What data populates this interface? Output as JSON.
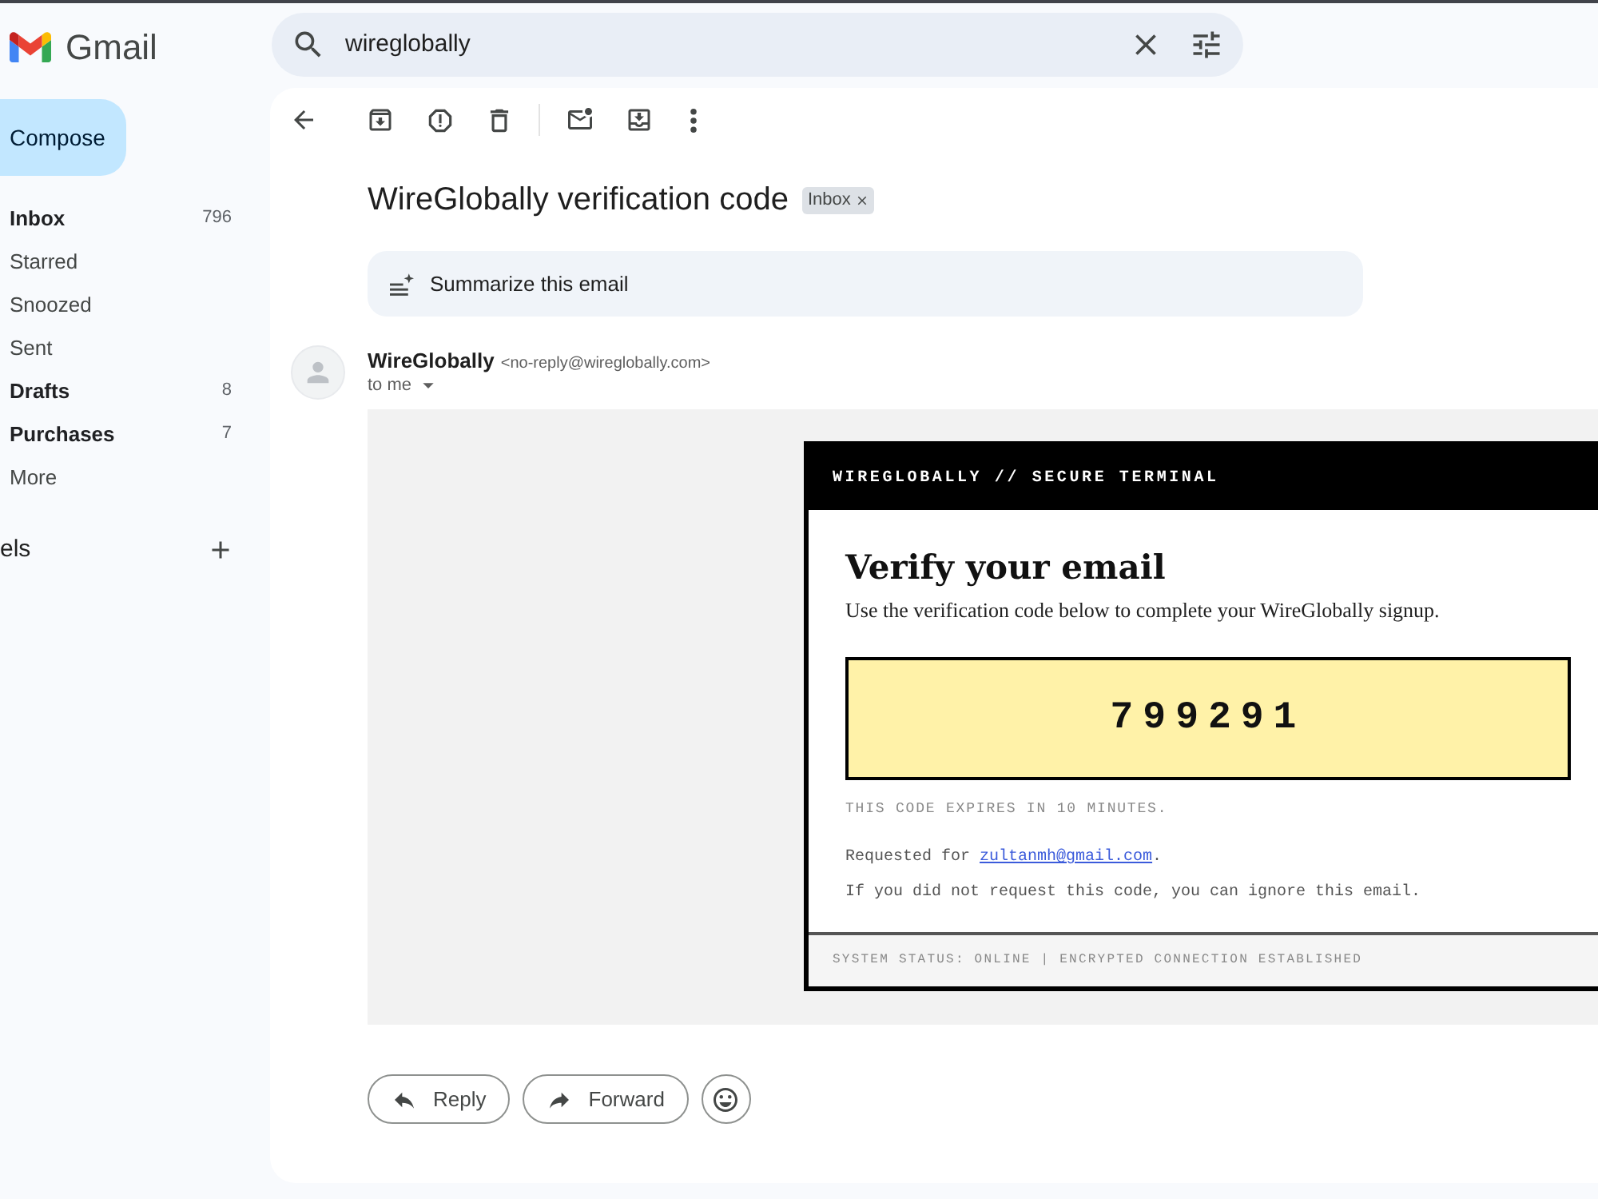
{
  "app": {
    "logo_text": "Gmail"
  },
  "search": {
    "value": "wireglobally"
  },
  "compose": {
    "label": "Compose"
  },
  "sidebar": {
    "items": [
      {
        "label": "Inbox",
        "count": "796",
        "unread": true
      },
      {
        "label": "Starred",
        "unread": false
      },
      {
        "label": "Snoozed",
        "unread": false
      },
      {
        "label": "Sent",
        "unread": false
      },
      {
        "label": "Drafts",
        "count": "8",
        "unread": true
      },
      {
        "label": "Purchases",
        "count": "7",
        "unread": true
      },
      {
        "label": "More",
        "unread": false
      }
    ],
    "labels_header": "els"
  },
  "message": {
    "subject": "WireGlobally verification code",
    "label_chip": "Inbox",
    "summarize": "Summarize this email",
    "sender_name": "WireGlobally",
    "sender_email": "<no-reply@wireglobally.com>",
    "recipient": "to me"
  },
  "email_body": {
    "header": "WIREGLOBALLY // SECURE TERMINAL",
    "heading": "Verify your email",
    "intro": "Use the verification code below to complete your WireGlobally signup.",
    "code": "799291",
    "expiry": "THIS CODE EXPIRES IN 10 MINUTES.",
    "requested": {
      "prefix": "Requested for ",
      "link": "zultanmh@gmail.com",
      "suffix": "."
    },
    "ignore_note": "If you did not request this code, you can ignore this email.",
    "footer": "SYSTEM STATUS: ONLINE | ENCRYPTED CONNECTION ESTABLISHED"
  },
  "actions": [
    {
      "kind": "reply",
      "label": "Reply"
    },
    {
      "kind": "forward",
      "label": "Forward"
    },
    {
      "kind": "emoji"
    }
  ]
}
